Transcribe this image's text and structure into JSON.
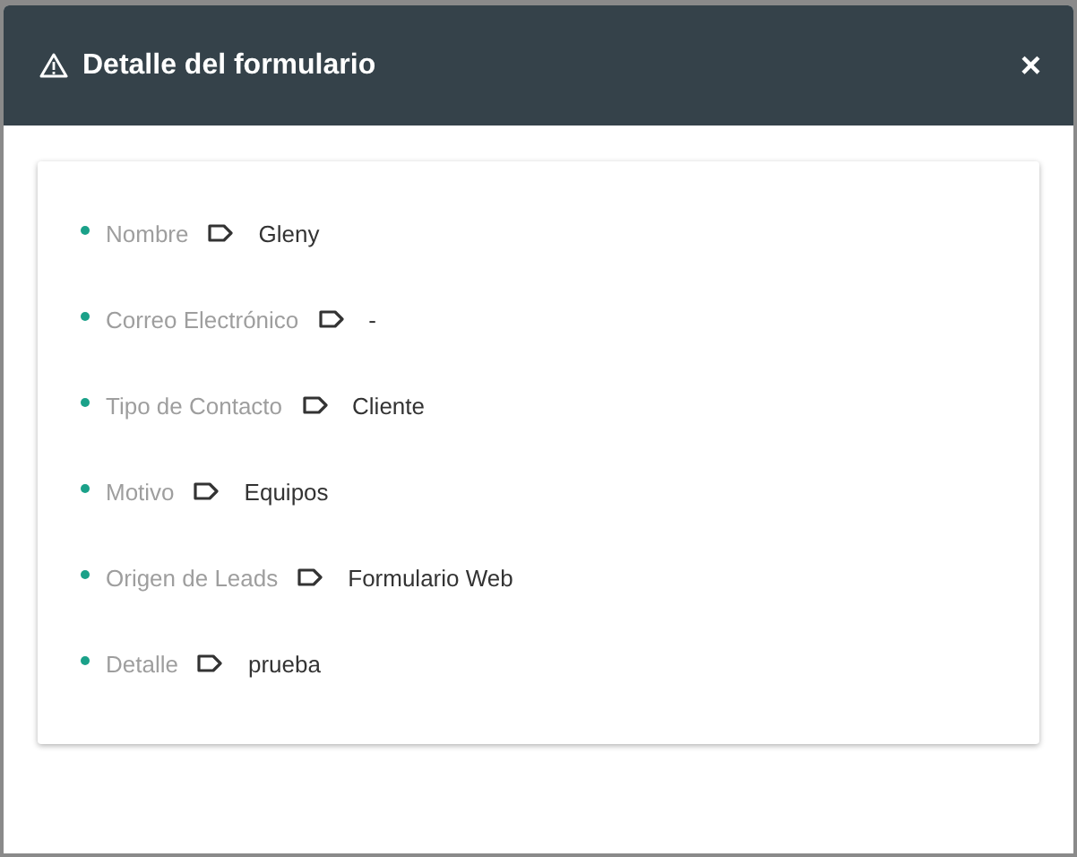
{
  "dialog": {
    "title": "Detalle del formulario",
    "close": "×"
  },
  "fields": [
    {
      "label": "Nombre",
      "value": "Gleny"
    },
    {
      "label": "Correo Electrónico",
      "value": "-"
    },
    {
      "label": "Tipo de Contacto",
      "value": "Cliente"
    },
    {
      "label": "Motivo",
      "value": "Equipos"
    },
    {
      "label": "Origen de Leads",
      "value": "Formulario Web"
    },
    {
      "label": "Detalle",
      "value": "prueba"
    }
  ]
}
